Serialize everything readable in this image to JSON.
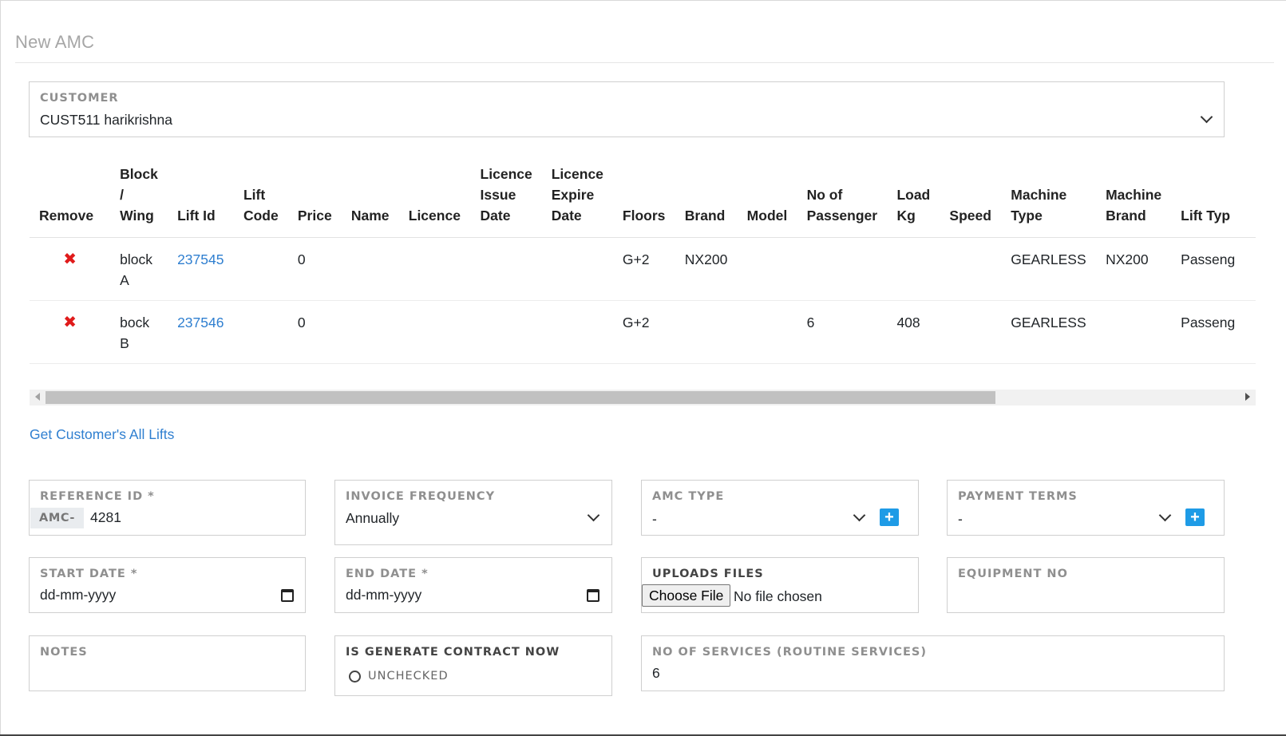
{
  "page": {
    "title": "New AMC"
  },
  "customer": {
    "label": "CUSTOMER",
    "value": "CUST511 harikrishna"
  },
  "lifts_table": {
    "columns": [
      "Remove",
      "Block / Wing",
      "Lift Id",
      "Lift Code",
      "Price",
      "Name",
      "Licence",
      "Licence Issue Date",
      "Licence Expire Date",
      "Floors",
      "Brand",
      "Model",
      "No of Passenger",
      "Load Kg",
      "Speed",
      "Machine Type",
      "Machine Brand",
      "Lift Typ"
    ],
    "rows": [
      {
        "remove": "✖",
        "block": "block A",
        "lift_id": "237545",
        "lift_code": "",
        "price": "0",
        "name": "",
        "licence": "",
        "issue_date": "",
        "expire_date": "",
        "floors": "G+2",
        "brand": "NX200",
        "model": "",
        "passengers": "",
        "load": "",
        "speed": "",
        "machine_type": "GEARLESS",
        "machine_brand": "NX200",
        "lift_type": "Passeng"
      },
      {
        "remove": "✖",
        "block": "bock B",
        "lift_id": "237546",
        "lift_code": "",
        "price": "0",
        "name": "",
        "licence": "",
        "issue_date": "",
        "expire_date": "",
        "floors": "G+2",
        "brand": "",
        "model": "",
        "passengers": "6",
        "load": "408",
        "speed": "",
        "machine_type": "GEARLESS",
        "machine_brand": "",
        "lift_type": "Passeng"
      }
    ]
  },
  "get_lifts_link": "Get Customer's All Lifts",
  "form": {
    "reference_id": {
      "label": "REFERENCE ID *",
      "prefix": "AMC-",
      "value": "4281"
    },
    "invoice_frequency": {
      "label": "INVOICE FREQUENCY",
      "value": "Annually"
    },
    "amc_type": {
      "label": "AMC TYPE",
      "value": "-",
      "add": "+"
    },
    "payment_terms": {
      "label": "PAYMENT TERMS",
      "value": "-",
      "add": "+"
    },
    "start_date": {
      "label": "START DATE *",
      "placeholder": "dd-mm-yyyy"
    },
    "end_date": {
      "label": "END DATE *",
      "placeholder": "dd-mm-yyyy"
    },
    "uploads": {
      "label": "UPLOADS FILES",
      "button": "Choose File",
      "status": "No file chosen"
    },
    "equipment_no": {
      "label": "EQUIPMENT NO",
      "value": ""
    },
    "notes": {
      "label": "NOTES",
      "value": ""
    },
    "generate_contract": {
      "label": "IS GENERATE CONTRACT NOW",
      "state": "UNCHECKED"
    },
    "no_of_services": {
      "label": "NO OF SERVICES (ROUTINE SERVICES)",
      "value": "6"
    }
  }
}
